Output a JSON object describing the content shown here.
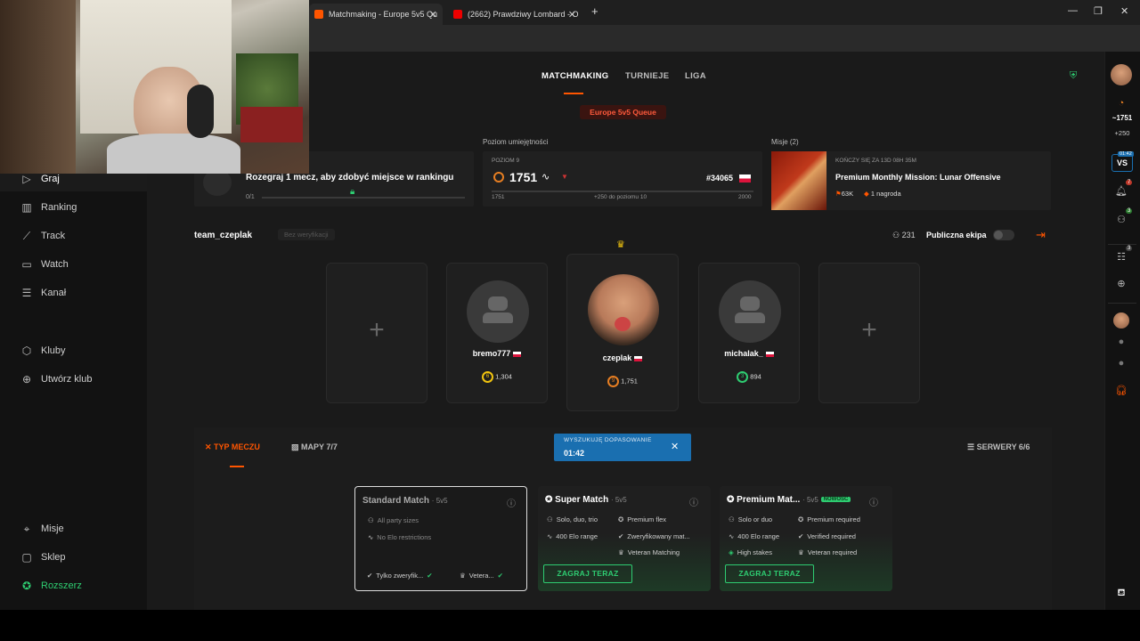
{
  "browser": {
    "tabs": [
      {
        "title": "Matchmaking - Europe 5v5 Qu",
        "active": true
      },
      {
        "title": "(2662) Prawdziwy Lombard - O",
        "active": false
      }
    ],
    "new_tab": "+",
    "window_controls": [
      "—",
      "❐",
      "✕"
    ]
  },
  "sidebar": {
    "items": [
      {
        "label": "Graj",
        "icon": "play-icon"
      },
      {
        "label": "Ranking",
        "icon": "bar-chart-icon"
      },
      {
        "label": "Track",
        "icon": "trend-icon"
      },
      {
        "label": "Watch",
        "icon": "screen-icon"
      },
      {
        "label": "Kanał",
        "icon": "feed-icon"
      }
    ],
    "club_items": [
      {
        "label": "Kluby",
        "icon": "clubs-icon"
      },
      {
        "label": "Utwórz klub",
        "icon": "plus-circle-icon"
      }
    ],
    "bottom_items": [
      {
        "label": "Misje",
        "icon": "missions-icon"
      },
      {
        "label": "Sklep",
        "icon": "shop-icon"
      },
      {
        "label": "Rozszerz",
        "icon": "expand-icon"
      }
    ]
  },
  "topnav": {
    "tabs": [
      "MATCHMAKING",
      "TURNIEJE",
      "LIGA"
    ],
    "active": 0
  },
  "queue": {
    "label": "Europe 5v5 Queue"
  },
  "ranking_card": {
    "title": "Rozegraj 1 mecz, aby zdobyć miejsce w rankingu",
    "progress": "0/1"
  },
  "skill": {
    "heading": "Poziom umiejętności",
    "level_label": "POZIOM 9",
    "elo": "1751",
    "rank": "#34065",
    "min": "1751",
    "next": "+250 do poziomu 10",
    "max": "2000"
  },
  "missions": {
    "heading": "Misje (2)",
    "ends": "KOŃCZY SIĘ ZA 13D 08H 35M",
    "title": "Premium Monthly Mission: Lunar Offensive",
    "count": "63K",
    "reward": "1 nagroda"
  },
  "team": {
    "name": "team_czeplak",
    "verify": "Bez weryfikacji",
    "members_count": "231",
    "visibility": "Publiczna ekipa",
    "players": [
      {
        "empty": true
      },
      {
        "name": "bremo777",
        "level": "6",
        "elo": "1,304",
        "color": "#f1c40f"
      },
      {
        "name": "czeplak",
        "level": "9",
        "elo": "1,751",
        "color": "#e67e22",
        "leader": true
      },
      {
        "name": "michalak_",
        "level": "3",
        "elo": "894",
        "color": "#2ecc71"
      },
      {
        "empty": true
      }
    ]
  },
  "match_bar": {
    "tab_type": "TYP MECZU",
    "tab_maps": "MAPY 7/7",
    "search_label": "WYSZUKUJĘ DOPASOWANIE",
    "search_timer": "01:42",
    "servers": "SERWERY 6/6"
  },
  "modes": [
    {
      "title": "Standard Match",
      "sub": "5v5",
      "features": [
        [
          "All party sizes"
        ],
        [
          "No Elo restrictions"
        ]
      ],
      "tags": [
        "Tylko zweryfik...",
        "Vetera..."
      ],
      "selected": true
    },
    {
      "title": "Super Match",
      "sub": "5v5",
      "features": [
        [
          "Solo, duo, trio",
          "Premium flex"
        ],
        [
          "400 Elo range",
          "Zweryfikowany mat..."
        ],
        [
          "",
          "Veteran Matching"
        ]
      ],
      "button": "ZAGRAJ TERAZ"
    },
    {
      "title": "Premium Mat...",
      "sub": "5v5",
      "badge": "NOWOŚĆ",
      "features": [
        [
          "Solo or duo",
          "Premium required"
        ],
        [
          "400 Elo range",
          "Verified required"
        ],
        [
          "High stakes",
          "Veteran required"
        ]
      ],
      "button": "ZAGRAJ TERAZ"
    }
  ],
  "rightbar": {
    "elo": "~1751",
    "gain": "+250",
    "timer": "01:42",
    "vs": "VS",
    "notif1": "7",
    "notif2": "3",
    "notif3": "3"
  },
  "colors": {
    "accent": "#ff5500",
    "green": "#2ecc71",
    "blue": "#1a6fb0"
  }
}
